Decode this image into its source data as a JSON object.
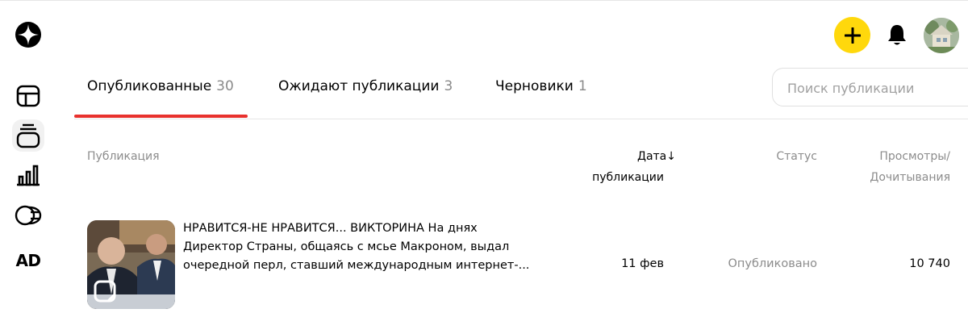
{
  "tabs": [
    {
      "label": "Опубликованные",
      "count": "30"
    },
    {
      "label": "Ожидают публикации",
      "count": "3"
    },
    {
      "label": "Черновики",
      "count": "1"
    }
  ],
  "search": {
    "placeholder": "Поиск публикации"
  },
  "sidebar": {
    "ad_label": "AD",
    "icons": [
      "logo-icon",
      "layout-icon",
      "publications-icon",
      "stats-icon",
      "coins-icon"
    ]
  },
  "header": {
    "icons": [
      "plus-icon",
      "bell-icon",
      "avatar"
    ]
  },
  "colors": {
    "accent_yellow": "#ffd80c",
    "tab_underline": "#e8312d",
    "muted_text": "#8c8c8c"
  },
  "table": {
    "headers": {
      "publication": "Публикация",
      "date_line1": "Дата",
      "date_sort": "↓",
      "date_line2": "публикации",
      "status": "Статус",
      "views_line1": "Просмотры/",
      "views_line2": "Дочитывания"
    },
    "rows": [
      {
        "title": "НРАВИТСЯ-НЕ НРАВИТСЯ... ВИКТОРИНА На днях Директор Страны, общаясь с мсье Макроном, выдал очередной перл, ставший международным интернет-...",
        "date": "11 фев",
        "status": "Опубликовано",
        "views": "10 740"
      }
    ]
  }
}
